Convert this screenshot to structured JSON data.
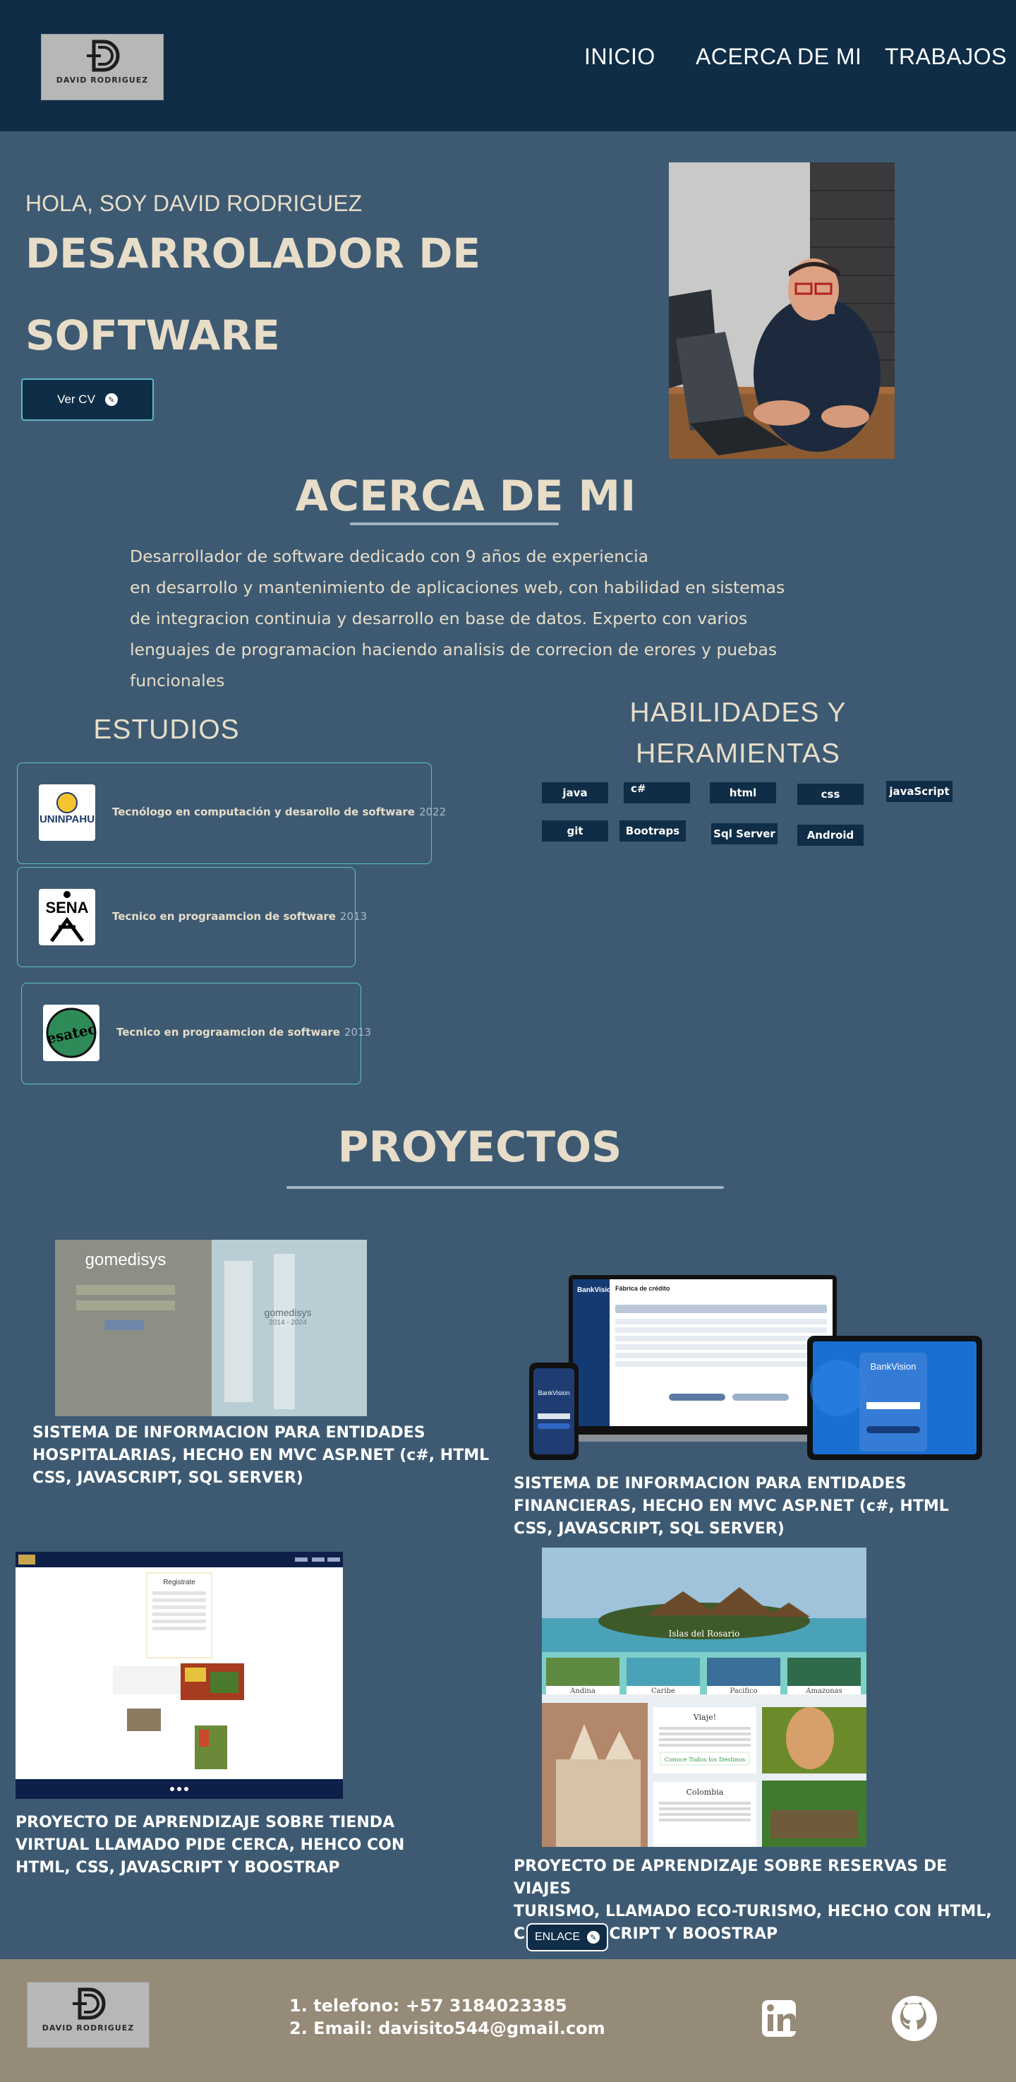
{
  "brand": {
    "logo_text": "DAVID RODRIGUEZ"
  },
  "nav": {
    "items": [
      "INICIO",
      "ACERCA DE MI",
      "TRABAJOS"
    ]
  },
  "hero": {
    "greeting": "HOLA, SOY DAVID RODRIGUEZ",
    "title_line1": "DESARROLADOR DE",
    "title_line2": "SOFTWARE",
    "cv_button": "Ver CV"
  },
  "about": {
    "title": "ACERCA DE MI",
    "lines": [
      "Desarrollador de software dedicado con 9 años de experiencia",
      "en desarrollo y mantenimiento de aplicaciones web, con habilidad en sistemas",
      "de integracion continuia y desarrollo en base de datos. Experto con varios",
      "lenguajes de programacion haciendo analisis de correcion de erores y puebas",
      "funcionales"
    ]
  },
  "studies": {
    "title": "ESTUDIOS",
    "items": [
      {
        "logo_label": "UNINPAHU",
        "text": "Tecnólogo en computación y desarollo de software",
        "year": "2022"
      },
      {
        "logo_label": "SENA",
        "text": "Tecnico en prograamcion de software",
        "year": "2013"
      },
      {
        "logo_label": "esatec",
        "text": "Tecnico en prograamcion de software",
        "year": "2013"
      }
    ]
  },
  "skills": {
    "title_line1": "HABILIDADES Y",
    "title_line2": "HERAMIENTAS",
    "items": [
      "java",
      "c#",
      "html",
      "css",
      "javaScript",
      "git",
      "Bootraps",
      "Sql Server",
      "Android"
    ]
  },
  "projects": {
    "title": "PROYECTOS",
    "items": [
      {
        "image_text": "gomedisys",
        "image_sub": "2014 - 2024",
        "caption": [
          "SISTEMA DE  INFORMACION  PARA ENTIDADES",
          "HOSPITALARIAS, HECHO EN MVC ASP.NET (c#, HTML",
          "CSS, JAVASCRIPT, SQL SERVER)"
        ]
      },
      {
        "image_text": "BankVision",
        "image_sub": "Fábrica de crédito",
        "caption": [
          "SISTEMA DE  INFORMACION  PARA ENTIDADES",
          "FINANCIERAS, HECHO EN MVC ASP.NET (c#, HTML",
          "CSS, JAVASCRIPT, SQL SERVER)"
        ]
      },
      {
        "image_text": "Registrate",
        "caption": [
          "PROYECTO DE APRENDIZAJE SOBRE TIENDA",
          "VIRTUAL LLAMADO PIDE CERCA, HEHCO CON",
          "HTML, CSS, JAVASCRIPT Y BOOSTRAP"
        ]
      },
      {
        "image_text": "Islas del Rosario",
        "regions": [
          "Andina",
          "Caribe",
          "Pacifico",
          "Amazonas"
        ],
        "card1_title": "Viaje!",
        "card1_button": "Conoce Todos los Destinos",
        "card2_title": "Colombia",
        "caption": [
          "PROYECTO DE APRENDIZAJE SOBRE RESERVAS DE VIAJES",
          "TURISMO, LLAMADO ECO-TURISMO, HECHO CON HTML,",
          "CSS, JAVASCRIPT Y BOOSTRAP"
        ],
        "link_button": "ENLACE"
      }
    ]
  },
  "footer": {
    "phone": "1.  telefono:  +57 3184023385",
    "email": "2. Email: davisito544@gmail.com"
  },
  "colors": {
    "header_bg": "#0f2d47",
    "page_bg": "#3d5a72",
    "accent_text": "#e7ddc8",
    "card_border": "#5dc3c8",
    "footer_bg": "#968a78"
  },
  "icons": [
    "pencil-icon",
    "linkedin-icon",
    "github-icon"
  ]
}
